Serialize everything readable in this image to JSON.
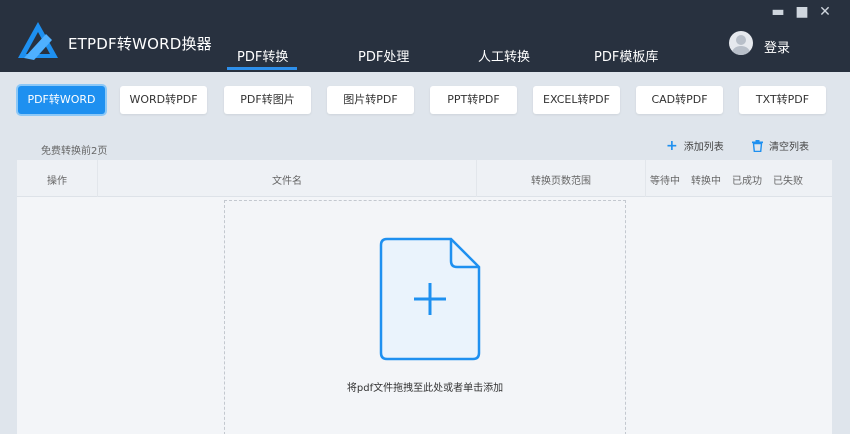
{
  "app": {
    "title": "ETPDF转WORD换器",
    "login_label": "登录"
  },
  "nav": {
    "tabs": [
      "PDF转换",
      "PDF处理",
      "人工转换",
      "PDF模板库"
    ],
    "active": "PDF转换"
  },
  "window_controls": {
    "minimize": "▬",
    "maximize": "■",
    "close": "✕"
  },
  "conversions": {
    "items": [
      "PDF转WORD",
      "WORD转PDF",
      "PDF转图片",
      "图片转PDF",
      "PPT转PDF",
      "EXCEL转PDF",
      "CAD转PDF",
      "TXT转PDF"
    ],
    "active": "PDF转WORD"
  },
  "info": {
    "free_text": "免费转换前2页"
  },
  "actions": {
    "add_label": "添加列表",
    "add_icon": "plus-icon",
    "clear_label": "清空列表",
    "clear_icon": "trash-icon"
  },
  "table": {
    "columns": [
      "操作",
      "文件名",
      "转换页数范围",
      "等待中",
      "转换中",
      "已成功",
      "已失败"
    ]
  },
  "dropzone": {
    "hint": "将pdf文件拖拽至此处或者单击添加",
    "icon": "file-add-icon"
  },
  "colors": {
    "accent": "#1e90f0",
    "topbar": "#28313f"
  }
}
